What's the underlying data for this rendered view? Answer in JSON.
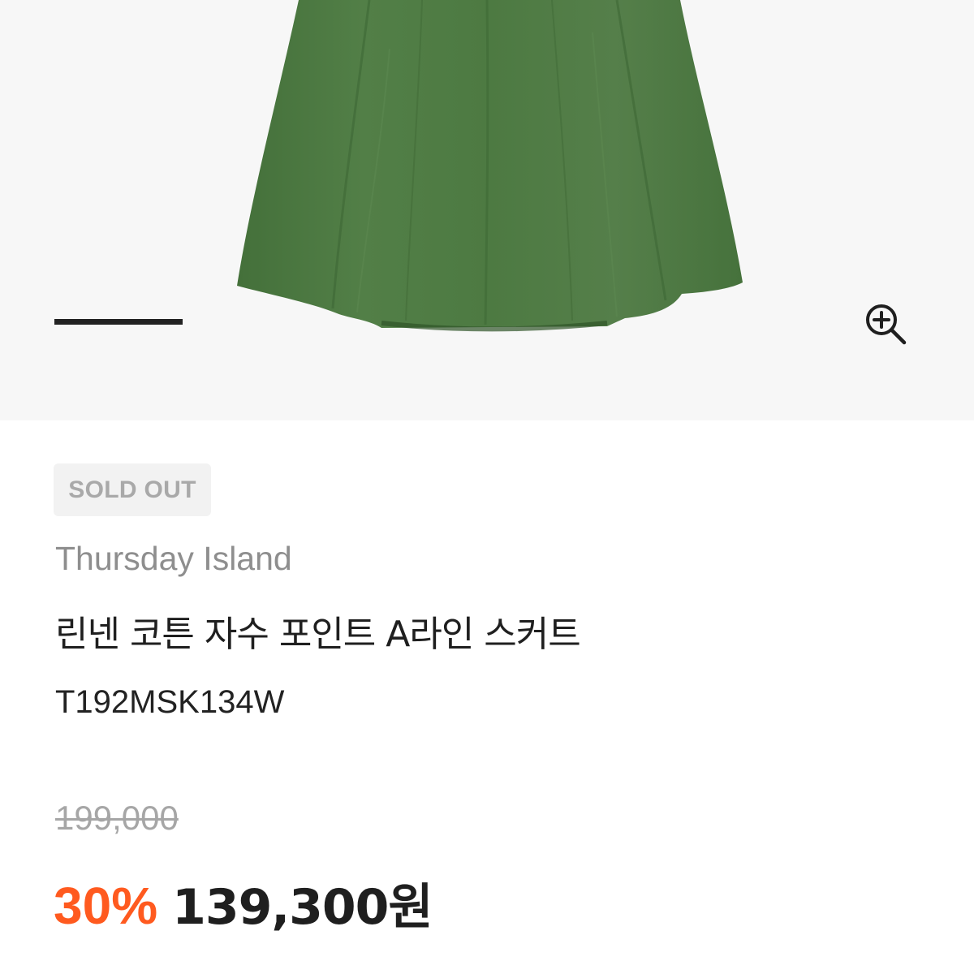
{
  "product": {
    "badge": "SOLD OUT",
    "brand": "Thursday Island",
    "name": "린넨 코튼 자수 포인트 A라인 스커트",
    "code": "T192MSK134W",
    "original_price": "199,000",
    "discount_rate": "30%",
    "sale_price": "139,300원"
  },
  "gallery": {
    "zoom_icon": "zoom-in-icon",
    "image_subject": "green-a-line-skirt"
  },
  "colors": {
    "skirt_green": "#4f7a43",
    "discount_orange": "#ff5a1f",
    "image_background": "#f7f7f7",
    "badge_background": "#f2f2f2"
  }
}
